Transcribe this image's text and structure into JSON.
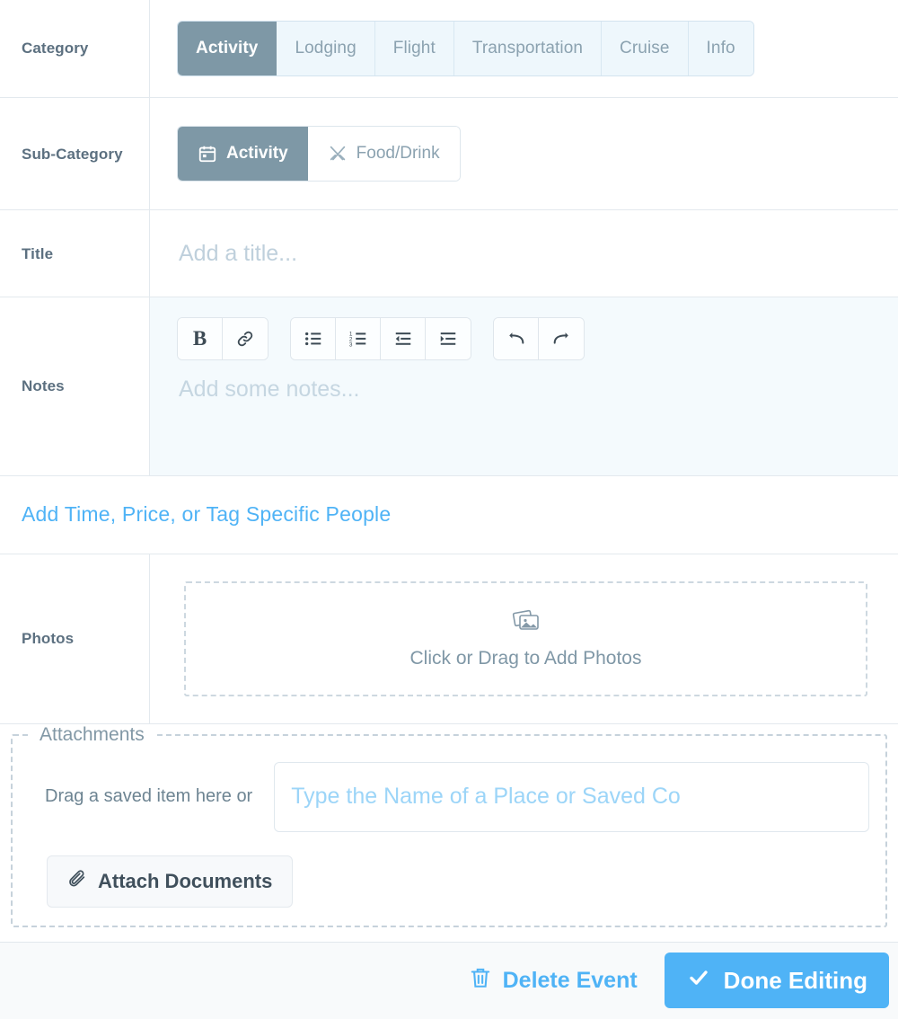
{
  "category": {
    "label": "Category",
    "tabs": [
      {
        "label": "Activity",
        "active": true
      },
      {
        "label": "Lodging",
        "active": false
      },
      {
        "label": "Flight",
        "active": false
      },
      {
        "label": "Transportation",
        "active": false
      },
      {
        "label": "Cruise",
        "active": false
      },
      {
        "label": "Info",
        "active": false
      }
    ]
  },
  "subcategory": {
    "label": "Sub-Category",
    "options": [
      {
        "label": "Activity",
        "icon": "calendar-icon",
        "active": true
      },
      {
        "label": "Food/Drink",
        "icon": "fork-knife-icon",
        "active": false
      }
    ]
  },
  "title": {
    "label": "Title",
    "placeholder": "Add a title...",
    "value": ""
  },
  "notes": {
    "label": "Notes",
    "placeholder": "Add some notes...",
    "value": "",
    "toolbar": [
      {
        "name": "bold-icon",
        "title": "Bold"
      },
      {
        "name": "link-icon",
        "title": "Link"
      },
      {
        "name": "bullet-list-icon",
        "title": "Bulleted List"
      },
      {
        "name": "numbered-list-icon",
        "title": "Numbered List"
      },
      {
        "name": "outdent-icon",
        "title": "Outdent"
      },
      {
        "name": "indent-icon",
        "title": "Indent"
      },
      {
        "name": "undo-icon",
        "title": "Undo"
      },
      {
        "name": "redo-icon",
        "title": "Redo"
      }
    ]
  },
  "add_details": {
    "link_label": "Add Time, Price, or Tag Specific People"
  },
  "photos": {
    "label": "Photos",
    "dropzone_label": "Click or Drag to Add Photos",
    "icon": "photo-stack-icon"
  },
  "attachments": {
    "legend": "Attachments",
    "hint": "Drag a saved item here or",
    "input_placeholder": "Type the Name of a Place or Saved Co",
    "input_value": "",
    "attach_button_label": "Attach Documents",
    "attach_button_icon": "paperclip-icon"
  },
  "footer": {
    "delete_label": "Delete Event",
    "delete_icon": "trash-icon",
    "done_label": "Done Editing",
    "done_icon": "check-icon"
  },
  "colors": {
    "accent_blue": "#4fb3f6",
    "active_slate": "#7e98a6",
    "tab_inactive_bg": "#eef7fc",
    "notes_bg": "#f4fafd",
    "label_text": "#5c7080",
    "footer_bg": "#f8fafb",
    "border": "#e3e9ee"
  }
}
